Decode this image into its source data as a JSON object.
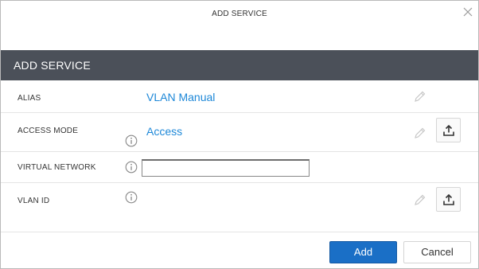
{
  "dialog": {
    "window_title": "ADD SERVICE",
    "section_title": "ADD SERVICE"
  },
  "fields": {
    "alias": {
      "label": "ALIAS",
      "value": "VLAN Manual"
    },
    "access_mode": {
      "label": "ACCESS MODE",
      "value": "Access"
    },
    "virtual_network": {
      "label": "VIRTUAL NETWORK",
      "value": "",
      "placeholder": ""
    },
    "vlan_id": {
      "label": "VLAN ID",
      "value": ""
    }
  },
  "buttons": {
    "add_label": "Add",
    "cancel_label": "Cancel"
  },
  "icons": {
    "close": "close-icon",
    "info": "info-icon",
    "edit": "pencil-icon",
    "upload": "upload-icon"
  },
  "colors": {
    "header_bg": "#4b5059",
    "link_value": "#1e88d8",
    "primary_button": "#1a6fc6"
  }
}
